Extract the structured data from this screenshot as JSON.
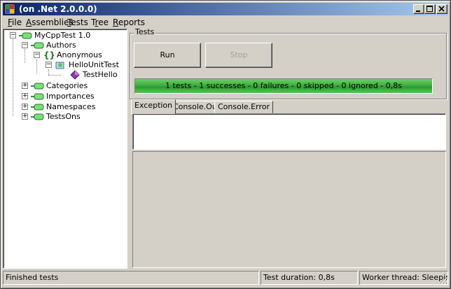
{
  "window": {
    "title": "(on .Net 2.0.0.0)"
  },
  "menu": [
    {
      "label": "File",
      "ul": "F",
      "rest": "ile"
    },
    {
      "label": "Assemblies",
      "ul": "A",
      "rest": "ssemblies"
    },
    {
      "label": "Tests",
      "ul": "T",
      "rest": "ests"
    },
    {
      "label": "Tree",
      "pre": "T",
      "ul": "r",
      "rest": "ee"
    },
    {
      "label": "Reports",
      "ul": "R",
      "rest": "eports"
    }
  ],
  "tree": {
    "root": "MyCppTest 1.0",
    "authors": "Authors",
    "anonymous": "Anonymous",
    "fixture": "HelloUnitTest",
    "test": "TestHello",
    "categories": "Categories",
    "importances": "Importances",
    "namespaces": "Namespaces",
    "testsons": "TestsOns"
  },
  "tests_group": {
    "title": "Tests",
    "run_label": "Run",
    "stop_label": "Stop",
    "summary": "1 tests - 1 successes - 0 failures  - 0 skipped - 0 ignored - 0,8s"
  },
  "tabs": [
    "Exception",
    "Console.Out",
    "Console.Error"
  ],
  "status": {
    "message": "Finished tests",
    "duration": "Test duration: 0,8s",
    "worker": "Worker thread: Sleeping"
  },
  "colors": {
    "progress_green": "#3fae3f",
    "title_blue": "#0a246a"
  }
}
